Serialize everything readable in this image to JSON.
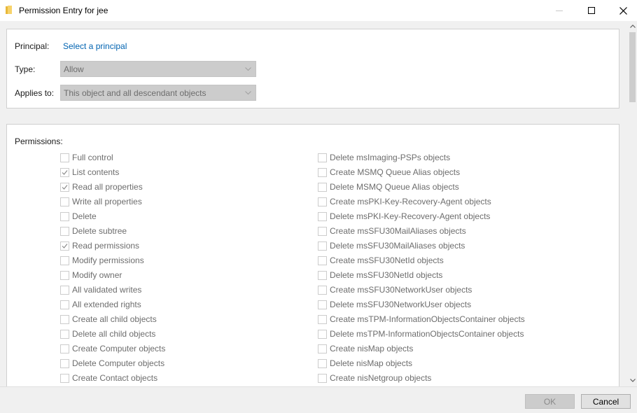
{
  "window": {
    "title": "Permission Entry for jee",
    "icon": "folder-icon"
  },
  "principal": {
    "label": "Principal:",
    "link": "Select a principal"
  },
  "type": {
    "label": "Type:",
    "value": "Allow"
  },
  "applies_to": {
    "label": "Applies to:",
    "value": "This object and all descendant objects"
  },
  "permissions": {
    "heading": "Permissions:",
    "left": [
      {
        "label": "Full control",
        "checked": false
      },
      {
        "label": "List contents",
        "checked": true
      },
      {
        "label": "Read all properties",
        "checked": true
      },
      {
        "label": "Write all properties",
        "checked": false
      },
      {
        "label": "Delete",
        "checked": false
      },
      {
        "label": "Delete subtree",
        "checked": false
      },
      {
        "label": "Read permissions",
        "checked": true
      },
      {
        "label": "Modify permissions",
        "checked": false
      },
      {
        "label": "Modify owner",
        "checked": false
      },
      {
        "label": "All validated writes",
        "checked": false
      },
      {
        "label": "All extended rights",
        "checked": false
      },
      {
        "label": "Create all child objects",
        "checked": false
      },
      {
        "label": "Delete all child objects",
        "checked": false
      },
      {
        "label": "Create Computer objects",
        "checked": false
      },
      {
        "label": "Delete Computer objects",
        "checked": false
      },
      {
        "label": "Create Contact objects",
        "checked": false
      }
    ],
    "right": [
      {
        "label": "Delete msImaging-PSPs objects",
        "checked": false
      },
      {
        "label": "Create MSMQ Queue Alias objects",
        "checked": false
      },
      {
        "label": "Delete MSMQ Queue Alias objects",
        "checked": false
      },
      {
        "label": "Create msPKI-Key-Recovery-Agent objects",
        "checked": false
      },
      {
        "label": "Delete msPKI-Key-Recovery-Agent objects",
        "checked": false
      },
      {
        "label": "Create msSFU30MailAliases objects",
        "checked": false
      },
      {
        "label": "Delete msSFU30MailAliases objects",
        "checked": false
      },
      {
        "label": "Create msSFU30NetId objects",
        "checked": false
      },
      {
        "label": "Delete msSFU30NetId objects",
        "checked": false
      },
      {
        "label": "Create msSFU30NetworkUser objects",
        "checked": false
      },
      {
        "label": "Delete msSFU30NetworkUser objects",
        "checked": false
      },
      {
        "label": "Create msTPM-InformationObjectsContainer objects",
        "checked": false
      },
      {
        "label": "Delete msTPM-InformationObjectsContainer objects",
        "checked": false
      },
      {
        "label": "Create nisMap objects",
        "checked": false
      },
      {
        "label": "Delete nisMap objects",
        "checked": false
      },
      {
        "label": "Create nisNetgroup objects",
        "checked": false
      }
    ]
  },
  "buttons": {
    "ok": "OK",
    "cancel": "Cancel"
  },
  "colors": {
    "link": "#0063b1",
    "disabled_text": "#6d6d6d",
    "check": "#8a8a8a"
  }
}
